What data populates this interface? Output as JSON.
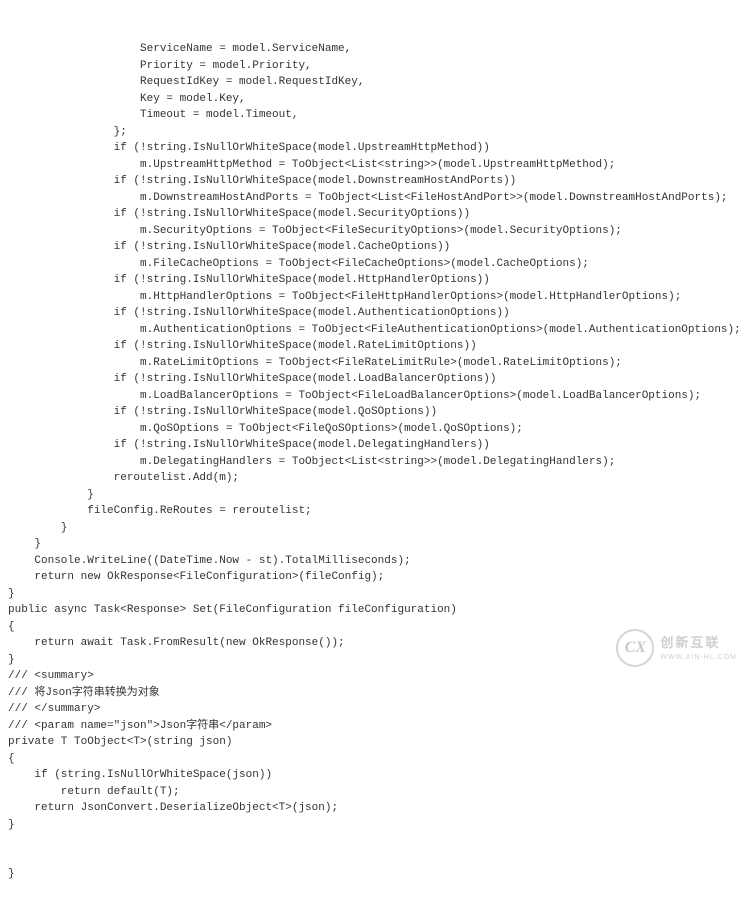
{
  "code": {
    "lines": [
      "                    ServiceName = model.ServiceName,",
      "                    Priority = model.Priority,",
      "                    RequestIdKey = model.RequestIdKey,",
      "                    Key = model.Key,",
      "                    Timeout = model.Timeout,",
      "                };",
      "                if (!string.IsNullOrWhiteSpace(model.UpstreamHttpMethod))",
      "                    m.UpstreamHttpMethod = ToObject<List<string>>(model.UpstreamHttpMethod);",
      "                if (!string.IsNullOrWhiteSpace(model.DownstreamHostAndPorts))",
      "                    m.DownstreamHostAndPorts = ToObject<List<FileHostAndPort>>(model.DownstreamHostAndPorts);",
      "                if (!string.IsNullOrWhiteSpace(model.SecurityOptions))",
      "                    m.SecurityOptions = ToObject<FileSecurityOptions>(model.SecurityOptions);",
      "                if (!string.IsNullOrWhiteSpace(model.CacheOptions))",
      "                    m.FileCacheOptions = ToObject<FileCacheOptions>(model.CacheOptions);",
      "                if (!string.IsNullOrWhiteSpace(model.HttpHandlerOptions))",
      "                    m.HttpHandlerOptions = ToObject<FileHttpHandlerOptions>(model.HttpHandlerOptions);",
      "                if (!string.IsNullOrWhiteSpace(model.AuthenticationOptions))",
      "                    m.AuthenticationOptions = ToObject<FileAuthenticationOptions>(model.AuthenticationOptions);",
      "                if (!string.IsNullOrWhiteSpace(model.RateLimitOptions))",
      "                    m.RateLimitOptions = ToObject<FileRateLimitRule>(model.RateLimitOptions);",
      "                if (!string.IsNullOrWhiteSpace(model.LoadBalancerOptions))",
      "                    m.LoadBalancerOptions = ToObject<FileLoadBalancerOptions>(model.LoadBalancerOptions);",
      "                if (!string.IsNullOrWhiteSpace(model.QoSOptions))",
      "                    m.QoSOptions = ToObject<FileQoSOptions>(model.QoSOptions);",
      "                if (!string.IsNullOrWhiteSpace(model.DelegatingHandlers))",
      "                    m.DelegatingHandlers = ToObject<List<string>>(model.DelegatingHandlers);",
      "                reroutelist.Add(m);",
      "            }",
      "            fileConfig.ReRoutes = reroutelist;",
      "        }",
      "    }",
      "    Console.WriteLine((DateTime.Now - st).TotalMilliseconds);",
      "    return new OkResponse<FileConfiguration>(fileConfig);",
      "}",
      "",
      "public async Task<Response> Set(FileConfiguration fileConfiguration)",
      "{",
      "    return await Task.FromResult(new OkResponse());",
      "}",
      "",
      "/// <summary>",
      "/// 将Json字符串转换为对象",
      "/// </summary>",
      "/// <param name=\"json\">Json字符串</param>",
      "private T ToObject<T>(string json)",
      "{",
      "    if (string.IsNullOrWhiteSpace(json))",
      "        return default(T);",
      "    return JsonConvert.DeserializeObject<T>(json);",
      "}"
    ],
    "closingBrace": "}"
  },
  "watermark": {
    "logo": "CX",
    "main": "创新互联",
    "sub": "WWW.XIN-HL.COM"
  }
}
